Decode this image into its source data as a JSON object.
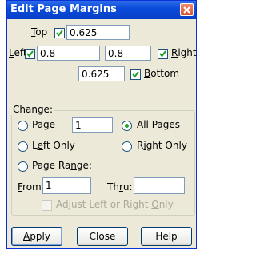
{
  "title": "Edit Page Margins",
  "margins": {
    "top_label_prefix": "",
    "top_label_u": "T",
    "top_label_rest": "op",
    "top_value": "0.625",
    "left_label_u": "L",
    "left_label_rest": "eft",
    "left_value": "0.8",
    "right_value": "0.8",
    "right_label_u": "R",
    "right_label_rest": "ight",
    "bottom_value": "0.625",
    "bottom_label_u": "B",
    "bottom_label_rest": "ottom"
  },
  "change": {
    "group_label": "Change:",
    "page_u": "P",
    "page_rest": "age",
    "page_value": "1",
    "all_pages": "All Pages",
    "left_only_u": "e",
    "left_only_pre": "L",
    "left_only_rest": "ft Only",
    "right_only_pre": "R",
    "right_only_u": "i",
    "right_only_rest": "ght Only",
    "page_range_pre": "Page Ra",
    "page_range_u": "n",
    "page_range_rest": "ge:",
    "from_u": "F",
    "from_rest": "rom:",
    "from_value": "1",
    "thru_pre": "Th",
    "thru_u": "r",
    "thru_rest": "u:",
    "thru_value": "",
    "adjust_pre": "Adjust Left or Right ",
    "adjust_u": "O",
    "adjust_rest": "nly"
  },
  "buttons": {
    "apply_u": "A",
    "apply_rest": "pply",
    "close": "Close",
    "help": "Help"
  },
  "colors": {
    "titlebar": "#0a4bdc",
    "face": "#ece9d8",
    "radio_dot": "#21a121"
  }
}
